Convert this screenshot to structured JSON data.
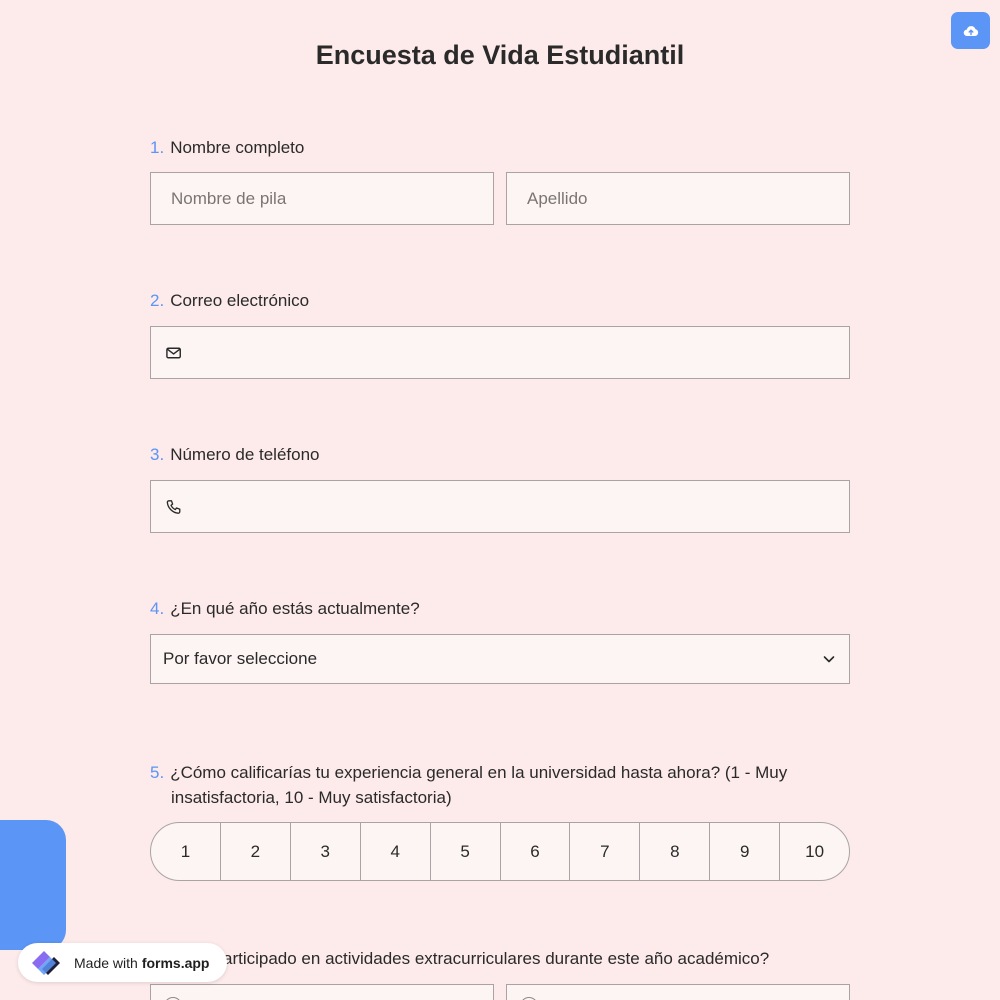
{
  "form": {
    "title": "Encuesta de Vida Estudiantil"
  },
  "toolbar": {
    "upload_icon": "cloud-upload-icon"
  },
  "questions": [
    {
      "number": "1.",
      "label": "Nombre completo",
      "first_name_placeholder": "Nombre de pila",
      "last_name_placeholder": "Apellido"
    },
    {
      "number": "2.",
      "label": "Correo electrónico",
      "icon": "envelope-icon",
      "value": ""
    },
    {
      "number": "3.",
      "label": "Número de teléfono",
      "icon": "phone-icon",
      "value": ""
    },
    {
      "number": "4.",
      "label": "¿En qué año estás actualmente?",
      "selected": "Por favor seleccione"
    },
    {
      "number": "5.",
      "label_line1": "¿Cómo calificarías tu experiencia general en la universidad hasta ahora? (1 - Muy",
      "label_line2": "insatisfactoria, 10 - Muy satisfactoria)",
      "options": [
        "1",
        "2",
        "3",
        "4",
        "5",
        "6",
        "7",
        "8",
        "9",
        "10"
      ]
    },
    {
      "label_partial": "articipado en actividades extracurriculares durante este año académico?"
    }
  ],
  "badge": {
    "made_with": "Made with",
    "brand": "forms.app"
  },
  "colors": {
    "background": "#fdeaea",
    "accent": "#5b95f5",
    "field_bg": "#fdf5f3"
  }
}
